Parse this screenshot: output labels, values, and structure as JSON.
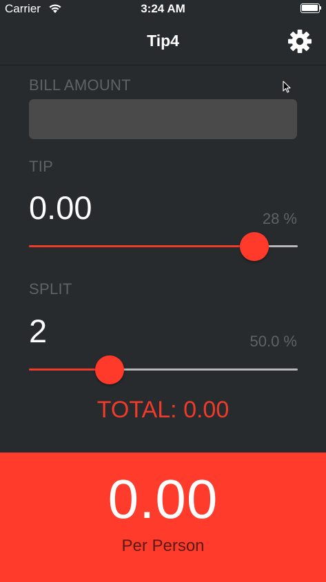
{
  "status_bar": {
    "carrier": "Carrier",
    "time": "3:24 AM",
    "wifi_icon": "wifi-icon",
    "battery_icon": "battery-icon"
  },
  "nav": {
    "title": "Tip4",
    "settings_icon": "gear-icon"
  },
  "bill": {
    "label": "BILL AMOUNT",
    "value": "",
    "placeholder": ""
  },
  "tip": {
    "label": "TIP",
    "value": "0.00",
    "percent_label": "28 %",
    "slider_fraction": 0.88
  },
  "split": {
    "label": "SPLIT",
    "value": "2",
    "percent_label": "50.0 %",
    "slider_fraction": 0.275
  },
  "total": "TOTAL: 0.00",
  "per_person": {
    "value": "0.00",
    "label": "Per Person"
  },
  "colors": {
    "background": "#272b2e",
    "accent": "#ff3b2c",
    "label": "#5f6366",
    "input": "#4a4a4a"
  }
}
